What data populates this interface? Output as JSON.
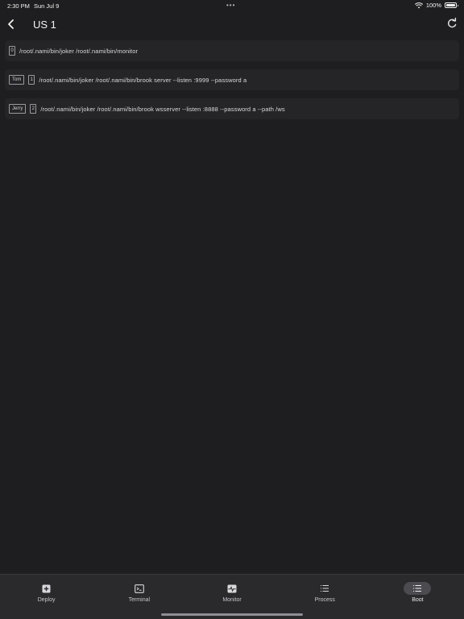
{
  "status_bar": {
    "time": "2:30 PM",
    "date": "Sun Jul 9",
    "dots": "•••",
    "battery_text": "100%",
    "battery_level": 1.0
  },
  "header": {
    "title": "US 1"
  },
  "entries": [
    {
      "tags": [],
      "index": "0",
      "command": "/root/.nami/bin/joker /root/.nami/bin/monitor"
    },
    {
      "tags": [
        "Tom"
      ],
      "index": "1",
      "command": "/root/.nami/bin/joker /root/.nami/bin/brook server --listen :9999 --password a"
    },
    {
      "tags": [
        "Jerry"
      ],
      "index": "2",
      "command": "/root/.nami/bin/joker /root/.nami/bin/brook wsserver --listen :8888 --password a --path /ws"
    }
  ],
  "tabs": [
    {
      "label": "Deploy",
      "icon": "plus-square-icon",
      "active": false
    },
    {
      "label": "Terminal",
      "icon": "terminal-icon",
      "active": false
    },
    {
      "label": "Monitor",
      "icon": "monitor-pulse-icon",
      "active": false
    },
    {
      "label": "Process",
      "icon": "list-icon",
      "active": false
    },
    {
      "label": "Boot",
      "icon": "boot-list-icon",
      "active": true
    }
  ],
  "colors": {
    "background": "#1e1e20",
    "row_background": "#252528",
    "tab_bar": "#2a2a2d",
    "active_tab_pill": "#4b4b50"
  }
}
